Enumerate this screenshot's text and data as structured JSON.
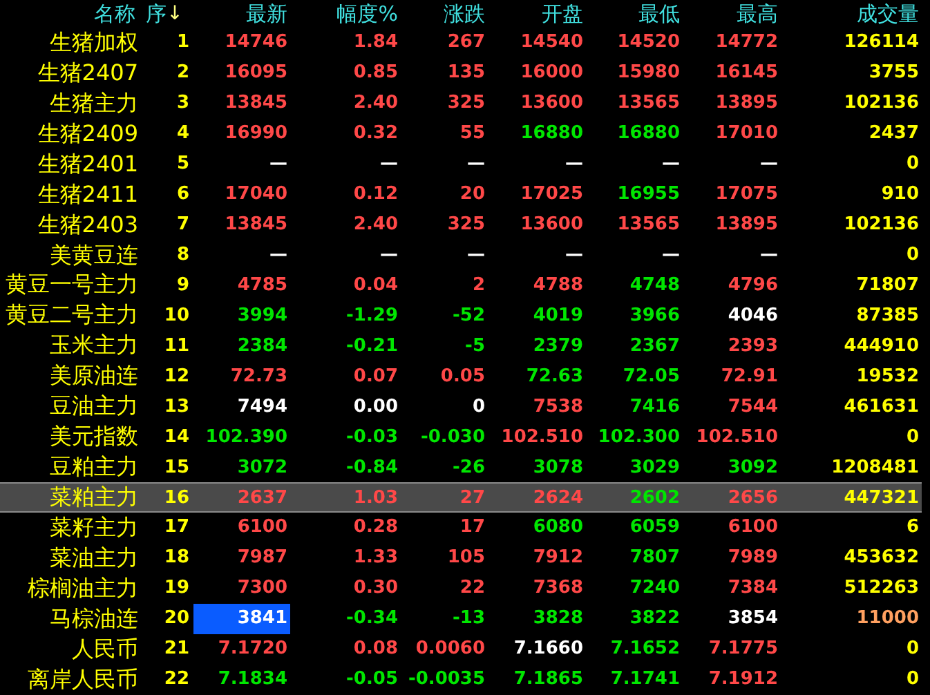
{
  "columns": [
    {
      "label": "名称"
    },
    {
      "label": "序",
      "sort_arrow": "↓"
    },
    {
      "label": "最新"
    },
    {
      "label": "幅度%"
    },
    {
      "label": "涨跌"
    },
    {
      "label": "开盘"
    },
    {
      "label": "最低"
    },
    {
      "label": "最高"
    },
    {
      "label": "成交量"
    }
  ],
  "rows": [
    {
      "name": "生猪加权",
      "seq": "1",
      "selected": false,
      "latest_focused": false,
      "cells": [
        {
          "text": "14746",
          "color": "#ff4848"
        },
        {
          "text": "1.84",
          "color": "#ff4848"
        },
        {
          "text": "267",
          "color": "#ff4848"
        },
        {
          "text": "14540",
          "color": "#ff4848"
        },
        {
          "text": "14520",
          "color": "#ff4848"
        },
        {
          "text": "14772",
          "color": "#ff4848"
        },
        {
          "text": "126114",
          "color": "#ffff00"
        }
      ]
    },
    {
      "name": "生猪2407",
      "seq": "2",
      "selected": false,
      "latest_focused": false,
      "cells": [
        {
          "text": "16095",
          "color": "#ff4848"
        },
        {
          "text": "0.85",
          "color": "#ff4848"
        },
        {
          "text": "135",
          "color": "#ff4848"
        },
        {
          "text": "16000",
          "color": "#ff4848"
        },
        {
          "text": "15980",
          "color": "#ff4848"
        },
        {
          "text": "16145",
          "color": "#ff4848"
        },
        {
          "text": "3755",
          "color": "#ffff00"
        }
      ]
    },
    {
      "name": "生猪主力",
      "seq": "3",
      "selected": false,
      "latest_focused": false,
      "cells": [
        {
          "text": "13845",
          "color": "#ff4848"
        },
        {
          "text": "2.40",
          "color": "#ff4848"
        },
        {
          "text": "325",
          "color": "#ff4848"
        },
        {
          "text": "13600",
          "color": "#ff4848"
        },
        {
          "text": "13565",
          "color": "#ff4848"
        },
        {
          "text": "13895",
          "color": "#ff4848"
        },
        {
          "text": "102136",
          "color": "#ffff00"
        }
      ]
    },
    {
      "name": "生猪2409",
      "seq": "4",
      "selected": false,
      "latest_focused": false,
      "cells": [
        {
          "text": "16990",
          "color": "#ff4848"
        },
        {
          "text": "0.32",
          "color": "#ff4848"
        },
        {
          "text": "55",
          "color": "#ff4848"
        },
        {
          "text": "16880",
          "color": "#00e600"
        },
        {
          "text": "16880",
          "color": "#00e600"
        },
        {
          "text": "17010",
          "color": "#ff4848"
        },
        {
          "text": "2437",
          "color": "#ffff00"
        }
      ]
    },
    {
      "name": "生猪2401",
      "seq": "5",
      "selected": false,
      "latest_focused": false,
      "cells": [
        {
          "text": "—",
          "color": "#ffffff"
        },
        {
          "text": "—",
          "color": "#ffffff"
        },
        {
          "text": "—",
          "color": "#ffffff"
        },
        {
          "text": "—",
          "color": "#ffffff"
        },
        {
          "text": "—",
          "color": "#ffffff"
        },
        {
          "text": "—",
          "color": "#ffffff"
        },
        {
          "text": "0",
          "color": "#ffff00"
        }
      ]
    },
    {
      "name": "生猪2411",
      "seq": "6",
      "selected": false,
      "latest_focused": false,
      "cells": [
        {
          "text": "17040",
          "color": "#ff4848"
        },
        {
          "text": "0.12",
          "color": "#ff4848"
        },
        {
          "text": "20",
          "color": "#ff4848"
        },
        {
          "text": "17025",
          "color": "#ff4848"
        },
        {
          "text": "16955",
          "color": "#00e600"
        },
        {
          "text": "17075",
          "color": "#ff4848"
        },
        {
          "text": "910",
          "color": "#ffff00"
        }
      ]
    },
    {
      "name": "生猪2403",
      "seq": "7",
      "selected": false,
      "latest_focused": false,
      "cells": [
        {
          "text": "13845",
          "color": "#ff4848"
        },
        {
          "text": "2.40",
          "color": "#ff4848"
        },
        {
          "text": "325",
          "color": "#ff4848"
        },
        {
          "text": "13600",
          "color": "#ff4848"
        },
        {
          "text": "13565",
          "color": "#ff4848"
        },
        {
          "text": "13895",
          "color": "#ff4848"
        },
        {
          "text": "102136",
          "color": "#ffff00"
        }
      ]
    },
    {
      "name": "美黄豆连",
      "seq": "8",
      "selected": false,
      "latest_focused": false,
      "cells": [
        {
          "text": "—",
          "color": "#ffffff"
        },
        {
          "text": "—",
          "color": "#ffffff"
        },
        {
          "text": "—",
          "color": "#ffffff"
        },
        {
          "text": "—",
          "color": "#ffffff"
        },
        {
          "text": "—",
          "color": "#ffffff"
        },
        {
          "text": "—",
          "color": "#ffffff"
        },
        {
          "text": "0",
          "color": "#ffff00"
        }
      ]
    },
    {
      "name": "黄豆一号主力",
      "seq": "9",
      "selected": false,
      "latest_focused": false,
      "cells": [
        {
          "text": "4785",
          "color": "#ff4848"
        },
        {
          "text": "0.04",
          "color": "#ff4848"
        },
        {
          "text": "2",
          "color": "#ff4848"
        },
        {
          "text": "4788",
          "color": "#ff4848"
        },
        {
          "text": "4748",
          "color": "#00e600"
        },
        {
          "text": "4796",
          "color": "#ff4848"
        },
        {
          "text": "71807",
          "color": "#ffff00"
        }
      ]
    },
    {
      "name": "黄豆二号主力",
      "seq": "10",
      "selected": false,
      "latest_focused": false,
      "cells": [
        {
          "text": "3994",
          "color": "#00e600"
        },
        {
          "text": "-1.29",
          "color": "#00e600"
        },
        {
          "text": "-52",
          "color": "#00e600"
        },
        {
          "text": "4019",
          "color": "#00e600"
        },
        {
          "text": "3966",
          "color": "#00e600"
        },
        {
          "text": "4046",
          "color": "#ffffff"
        },
        {
          "text": "87385",
          "color": "#ffff00"
        }
      ]
    },
    {
      "name": "玉米主力",
      "seq": "11",
      "selected": false,
      "latest_focused": false,
      "cells": [
        {
          "text": "2384",
          "color": "#00e600"
        },
        {
          "text": "-0.21",
          "color": "#00e600"
        },
        {
          "text": "-5",
          "color": "#00e600"
        },
        {
          "text": "2379",
          "color": "#00e600"
        },
        {
          "text": "2367",
          "color": "#00e600"
        },
        {
          "text": "2393",
          "color": "#ff4848"
        },
        {
          "text": "444910",
          "color": "#ffff00"
        }
      ]
    },
    {
      "name": "美原油连",
      "seq": "12",
      "selected": false,
      "latest_focused": false,
      "cells": [
        {
          "text": "72.73",
          "color": "#ff4848"
        },
        {
          "text": "0.07",
          "color": "#ff4848"
        },
        {
          "text": "0.05",
          "color": "#ff4848"
        },
        {
          "text": "72.63",
          "color": "#00e600"
        },
        {
          "text": "72.05",
          "color": "#00e600"
        },
        {
          "text": "72.91",
          "color": "#ff4848"
        },
        {
          "text": "19532",
          "color": "#ffff00"
        }
      ]
    },
    {
      "name": "豆油主力",
      "seq": "13",
      "selected": false,
      "latest_focused": false,
      "cells": [
        {
          "text": "7494",
          "color": "#ffffff"
        },
        {
          "text": "0.00",
          "color": "#ffffff"
        },
        {
          "text": "0",
          "color": "#ffffff"
        },
        {
          "text": "7538",
          "color": "#ff4848"
        },
        {
          "text": "7416",
          "color": "#00e600"
        },
        {
          "text": "7544",
          "color": "#ff4848"
        },
        {
          "text": "461631",
          "color": "#ffff00"
        }
      ]
    },
    {
      "name": "美元指数",
      "seq": "14",
      "selected": false,
      "latest_focused": false,
      "cells": [
        {
          "text": "102.390",
          "color": "#00e600"
        },
        {
          "text": "-0.03",
          "color": "#00e600"
        },
        {
          "text": "-0.030",
          "color": "#00e600"
        },
        {
          "text": "102.510",
          "color": "#ff4848"
        },
        {
          "text": "102.300",
          "color": "#00e600"
        },
        {
          "text": "102.510",
          "color": "#ff4848"
        },
        {
          "text": "0",
          "color": "#ffff00"
        }
      ]
    },
    {
      "name": "豆粕主力",
      "seq": "15",
      "selected": false,
      "latest_focused": false,
      "cells": [
        {
          "text": "3072",
          "color": "#00e600"
        },
        {
          "text": "-0.84",
          "color": "#00e600"
        },
        {
          "text": "-26",
          "color": "#00e600"
        },
        {
          "text": "3078",
          "color": "#00e600"
        },
        {
          "text": "3029",
          "color": "#00e600"
        },
        {
          "text": "3092",
          "color": "#00e600"
        },
        {
          "text": "1208481",
          "color": "#ffff00"
        }
      ]
    },
    {
      "name": "菜粕主力",
      "seq": "16",
      "selected": true,
      "latest_focused": false,
      "cells": [
        {
          "text": "2637",
          "color": "#ff4848"
        },
        {
          "text": "1.03",
          "color": "#ff4848"
        },
        {
          "text": "27",
          "color": "#ff4848"
        },
        {
          "text": "2624",
          "color": "#ff4848"
        },
        {
          "text": "2602",
          "color": "#00e600"
        },
        {
          "text": "2656",
          "color": "#ff4848"
        },
        {
          "text": "447321",
          "color": "#ffff00"
        }
      ]
    },
    {
      "name": "菜籽主力",
      "seq": "17",
      "selected": false,
      "latest_focused": false,
      "cells": [
        {
          "text": "6100",
          "color": "#ff4848"
        },
        {
          "text": "0.28",
          "color": "#ff4848"
        },
        {
          "text": "17",
          "color": "#ff4848"
        },
        {
          "text": "6080",
          "color": "#00e600"
        },
        {
          "text": "6059",
          "color": "#00e600"
        },
        {
          "text": "6100",
          "color": "#ff4848"
        },
        {
          "text": "6",
          "color": "#ffff00"
        }
      ]
    },
    {
      "name": "菜油主力",
      "seq": "18",
      "selected": false,
      "latest_focused": false,
      "cells": [
        {
          "text": "7987",
          "color": "#ff4848"
        },
        {
          "text": "1.33",
          "color": "#ff4848"
        },
        {
          "text": "105",
          "color": "#ff4848"
        },
        {
          "text": "7912",
          "color": "#ff4848"
        },
        {
          "text": "7807",
          "color": "#00e600"
        },
        {
          "text": "7989",
          "color": "#ff4848"
        },
        {
          "text": "453632",
          "color": "#ffff00"
        }
      ]
    },
    {
      "name": "棕榈油主力",
      "seq": "19",
      "selected": false,
      "latest_focused": false,
      "cells": [
        {
          "text": "7300",
          "color": "#ff4848"
        },
        {
          "text": "0.30",
          "color": "#ff4848"
        },
        {
          "text": "22",
          "color": "#ff4848"
        },
        {
          "text": "7368",
          "color": "#ff4848"
        },
        {
          "text": "7240",
          "color": "#00e600"
        },
        {
          "text": "7384",
          "color": "#ff4848"
        },
        {
          "text": "512263",
          "color": "#ffff00"
        }
      ]
    },
    {
      "name": "马棕油连",
      "seq": "20",
      "selected": false,
      "latest_focused": true,
      "cells": [
        {
          "text": "3841",
          "color": "#ffffff"
        },
        {
          "text": "-0.34",
          "color": "#00e600"
        },
        {
          "text": "-13",
          "color": "#00e600"
        },
        {
          "text": "3828",
          "color": "#00e600"
        },
        {
          "text": "3822",
          "color": "#00e600"
        },
        {
          "text": "3854",
          "color": "#ffffff"
        },
        {
          "text": "11000",
          "color": "#ffa060"
        }
      ]
    },
    {
      "name": "人民币",
      "seq": "21",
      "selected": false,
      "latest_focused": false,
      "cells": [
        {
          "text": "7.1720",
          "color": "#ff4848"
        },
        {
          "text": "0.08",
          "color": "#ff4848"
        },
        {
          "text": "0.0060",
          "color": "#ff4848"
        },
        {
          "text": "7.1660",
          "color": "#ffffff"
        },
        {
          "text": "7.1652",
          "color": "#00e600"
        },
        {
          "text": "7.1775",
          "color": "#ff4848"
        },
        {
          "text": "0",
          "color": "#ffff00"
        }
      ]
    },
    {
      "name": "离岸人民币",
      "seq": "22",
      "selected": false,
      "latest_focused": false,
      "cells": [
        {
          "text": "7.1834",
          "color": "#00e600"
        },
        {
          "text": "-0.05",
          "color": "#00e600"
        },
        {
          "text": "-0.0035",
          "color": "#00e600"
        },
        {
          "text": "7.1865",
          "color": "#00e600"
        },
        {
          "text": "7.1741",
          "color": "#00e600"
        },
        {
          "text": "7.1912",
          "color": "#ff4848"
        },
        {
          "text": "0",
          "color": "#ffff00"
        }
      ]
    }
  ]
}
